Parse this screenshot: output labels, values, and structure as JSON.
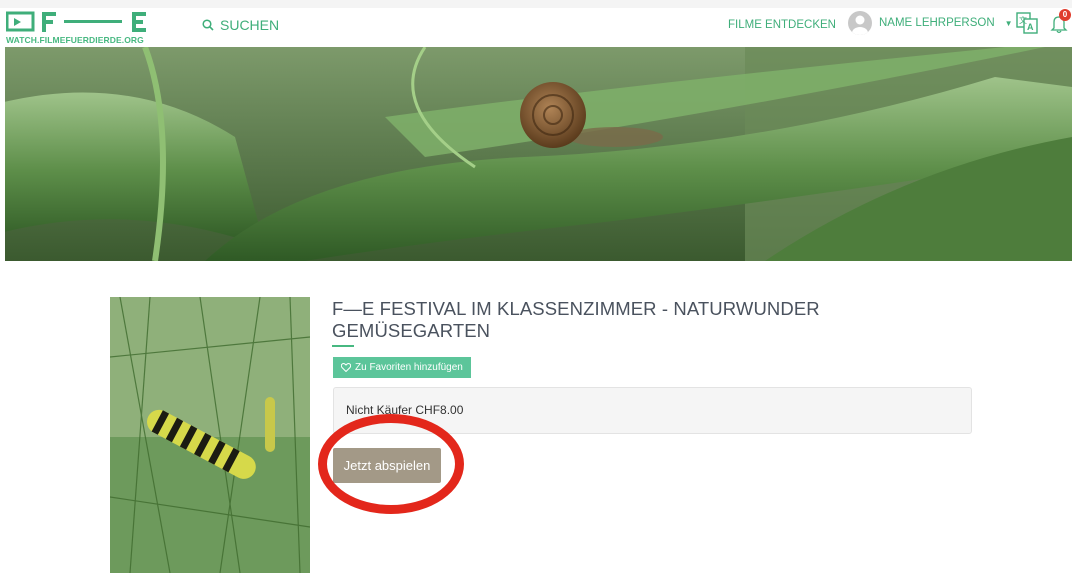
{
  "header": {
    "logo_url_text": "WATCH.FILMEFUERDIERDE.ORG",
    "search_label": "SUCHEN",
    "nav_discover_label": "FILME ENTDECKEN",
    "user_name": "NAME LEHRPERSON",
    "notification_count": "0",
    "logo_letters": "F—E"
  },
  "film": {
    "title_line1": "F—E FESTIVAL IM KLASSENZIMMER - NATURWUNDER",
    "title_line2": "GEMÜSEGARTEN",
    "favorite_label": "Zu Favoriten hinzufügen",
    "price_text": "Nicht Käufer CHF8.00",
    "play_label": "Jetzt abspielen"
  },
  "colors": {
    "accent": "#3fae7a",
    "play_button": "#a39987",
    "annotation_circle": "#e3271b",
    "notification_badge": "#e03b2c"
  },
  "icons": {
    "search": "search-icon",
    "user": "user-avatar-icon",
    "language": "language-icon",
    "bell": "bell-icon",
    "heart": "heart-icon"
  }
}
